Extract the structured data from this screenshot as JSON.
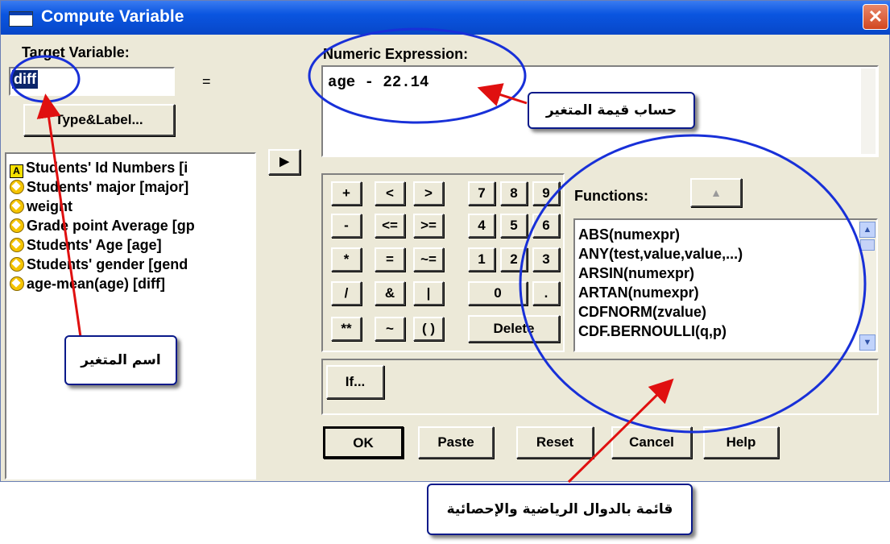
{
  "window": {
    "title": "Compute Variable",
    "close_glyph": "✕"
  },
  "target": {
    "label": "Target Variable:",
    "value": "diff",
    "equals": "=",
    "type_label_button": "Type&Label..."
  },
  "variables": [
    {
      "icon": "string-variable-icon",
      "label": "Students' Id Numbers [i"
    },
    {
      "icon": "numeric-variable-icon",
      "label": "Students' major [major]"
    },
    {
      "icon": "numeric-variable-icon",
      "label": "weight"
    },
    {
      "icon": "numeric-variable-icon",
      "label": "Grade point Average [gp"
    },
    {
      "icon": "numeric-variable-icon",
      "label": "Students' Age [age]"
    },
    {
      "icon": "numeric-variable-icon",
      "label": "Students' gender [gend"
    },
    {
      "icon": "numeric-variable-icon",
      "label": "age-mean(age) [diff]"
    }
  ],
  "string_icon_glyph": "A",
  "transfer_arrow": "▶",
  "expression": {
    "label": "Numeric Expression:",
    "value": "age - 22.14"
  },
  "keypad": {
    "operators": [
      "+",
      "<",
      ">",
      "-",
      "<=",
      ">=",
      "*",
      "=",
      "~=",
      "/",
      "&",
      "|",
      "**",
      "~",
      "( )"
    ],
    "digits": [
      "7",
      "8",
      "9",
      "4",
      "5",
      "6",
      "1",
      "2",
      "3",
      "0",
      "."
    ],
    "delete_label": "Delete"
  },
  "functions": {
    "label": "Functions:",
    "up_arrow": "▲",
    "items": [
      "ABS(numexpr)",
      "ANY(test,value,value,...)",
      "ARSIN(numexpr)",
      "ARTAN(numexpr)",
      "CDFNORM(zvalue)",
      "CDF.BERNOULLI(q,p)"
    ]
  },
  "if_button": "If...",
  "buttons": {
    "ok": "OK",
    "paste": "Paste",
    "reset": "Reset",
    "cancel": "Cancel",
    "help": "Help"
  },
  "annotations": {
    "expression_value": "حساب قيمة المتغير",
    "variable_name": "اسم المتغير",
    "functions_list": "قائمة بالدوال الرياضية والإحصائية"
  },
  "colors": {
    "annotation_ellipse": "#1830d8",
    "annotation_arrow": "#e01010",
    "title_bar": "#0a55e0"
  }
}
